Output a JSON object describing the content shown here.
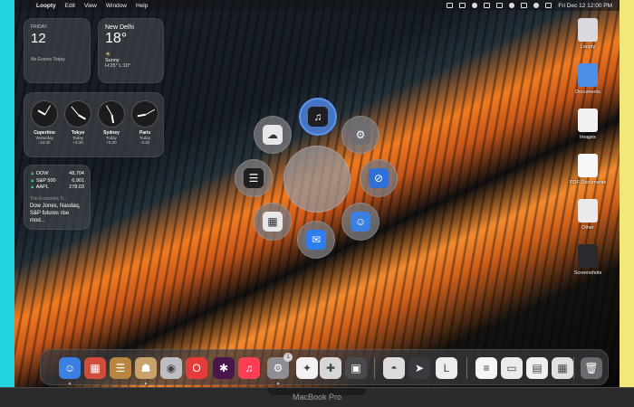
{
  "menubar": {
    "app_name": "Loopty",
    "items": [
      "Edit",
      "View",
      "Window",
      "Help"
    ],
    "datetime": "Fri Dec 12  12:00 PM"
  },
  "widgets": {
    "calendar": {
      "day": "FRIDAY",
      "date": "12",
      "events": "No Events Today"
    },
    "weather": {
      "city": "New Delhi",
      "temp": "18°",
      "condition": "Sunny",
      "high_low": "H:25° L:10°"
    },
    "clocks": [
      {
        "city": "Cupertino",
        "day": "Yesterday",
        "offset": "-10:30"
      },
      {
        "city": "Tokyo",
        "day": "Today",
        "offset": "+3:30"
      },
      {
        "city": "Sydney",
        "day": "Today",
        "offset": "+5:30"
      },
      {
        "city": "Paris",
        "day": "Today",
        "offset": "-4:30"
      }
    ],
    "stocks": {
      "rows": [
        {
          "symbol": "DOW",
          "value": "48,704"
        },
        {
          "symbol": "S&P 500",
          "value": "6,901"
        },
        {
          "symbol": "AAPL",
          "value": "278.03"
        }
      ],
      "source": "The Economic Ti...",
      "headline": "Dow Jones, Nasdaq, S&P futures rise mod..."
    }
  },
  "launcher": {
    "items": [
      {
        "name": "music",
        "glyph": "♫",
        "color": "#1f1f22"
      },
      {
        "name": "settings",
        "glyph": "⚙",
        "color": "#6d6d72"
      },
      {
        "name": "safari",
        "glyph": "⊘",
        "color": "#2f6fd8"
      },
      {
        "name": "finder",
        "glyph": "☺",
        "color": "#3b7fe0"
      },
      {
        "name": "mail",
        "glyph": "✉",
        "color": "#2f7ef0"
      },
      {
        "name": "calendar",
        "glyph": "▦",
        "color": "#e8e8ea"
      },
      {
        "name": "stocks",
        "glyph": "☰",
        "color": "#1f1f22"
      },
      {
        "name": "messages",
        "glyph": "☁",
        "color": "#e7e7e9"
      }
    ]
  },
  "desktop": [
    {
      "label": "Loopty",
      "color": "#d9d9de"
    },
    {
      "label": "Documents",
      "color": "#4d8fe6"
    },
    {
      "label": "Images",
      "color": "#f1f1f3"
    },
    {
      "label": "PDF Documents",
      "color": "#f7f7f9"
    },
    {
      "label": "Other",
      "color": "#eaeaec"
    },
    {
      "label": "Screenshots",
      "color": "#2a2a2e"
    }
  ],
  "dock": {
    "apps": [
      {
        "name": "finder",
        "glyph": "☺",
        "color": "#3c7fe2"
      },
      {
        "name": "launchpad",
        "glyph": "▦",
        "color": "#d04d3b"
      },
      {
        "name": "stocks",
        "glyph": "☰",
        "color": "#b8863e"
      },
      {
        "name": "contacts",
        "glyph": "☗",
        "color": "#c8a26a"
      },
      {
        "name": "system",
        "glyph": "◉",
        "color": "#bdbdc2"
      },
      {
        "name": "opera",
        "glyph": "O",
        "color": "#e73a3a"
      },
      {
        "name": "slack",
        "glyph": "✱",
        "color": "#4a154b"
      },
      {
        "name": "music",
        "glyph": "♫",
        "color": "#fa3f55"
      },
      {
        "name": "settings",
        "glyph": "⚙",
        "color": "#8e8e93"
      },
      {
        "name": "spark",
        "glyph": "✦",
        "color": "#f2f2f4"
      },
      {
        "name": "tools",
        "glyph": "✚",
        "color": "#d7d7da"
      },
      {
        "name": "photos",
        "glyph": "▣",
        "color": "#4a4a4e"
      },
      {
        "name": "drive",
        "glyph": "◓",
        "color": "#dcdcdf"
      },
      {
        "name": "maps",
        "glyph": "➤",
        "color": "#3a3a3e"
      },
      {
        "name": "l-app",
        "glyph": "L",
        "color": "#ededf0"
      },
      {
        "name": "document",
        "glyph": "≡",
        "color": "#f5f5f7"
      },
      {
        "name": "screenshot-1",
        "glyph": "▭",
        "color": "#ebebed"
      },
      {
        "name": "screenshot-2",
        "glyph": "▤",
        "color": "#f0f0f2"
      },
      {
        "name": "screenshot-3",
        "glyph": "▦",
        "color": "#e0e0e3"
      },
      {
        "name": "trash",
        "glyph": "🗑",
        "color": "#6a6a6e"
      }
    ],
    "settings_badge": "1"
  },
  "device": {
    "model": "MacBook Pro"
  }
}
